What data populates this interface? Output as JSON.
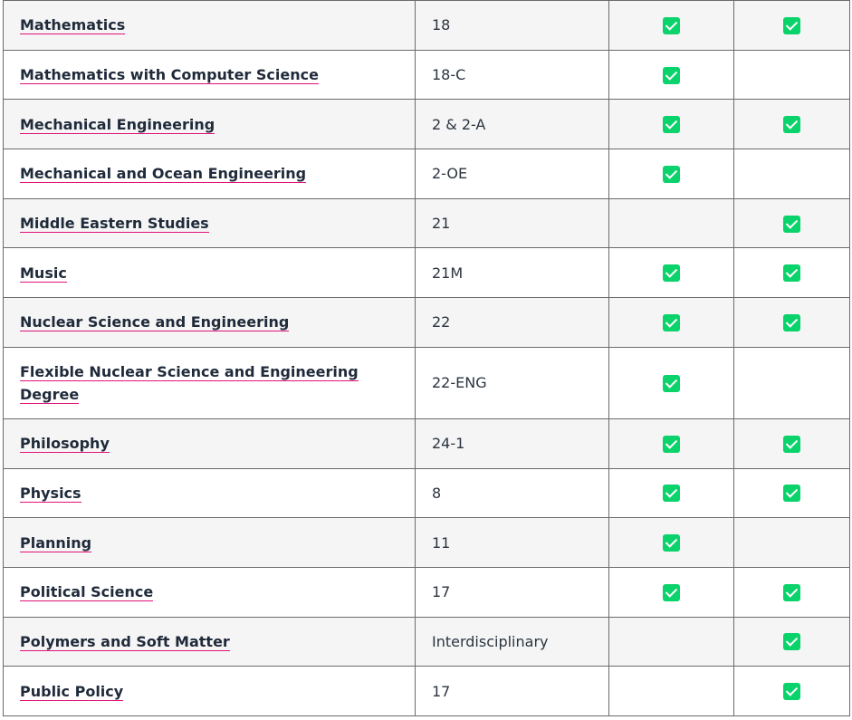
{
  "colors": {
    "check": "#0ad36b",
    "link_underline": "#e0137a",
    "row_alt": "#f5f5f5"
  },
  "rows": [
    {
      "name": "Mathematics",
      "code": "18",
      "col1": true,
      "col2": true
    },
    {
      "name": "Mathematics with Computer Science",
      "code": "18-C",
      "col1": true,
      "col2": false
    },
    {
      "name": "Mechanical Engineering",
      "code": "2 & 2-A",
      "col1": true,
      "col2": true
    },
    {
      "name": "Mechanical and Ocean Engineering",
      "code": "2-OE",
      "col1": true,
      "col2": false
    },
    {
      "name": "Middle Eastern Studies",
      "code": "21",
      "col1": false,
      "col2": true
    },
    {
      "name": "Music",
      "code": "21M",
      "col1": true,
      "col2": true
    },
    {
      "name": "Nuclear Science and Engineering",
      "code": "22",
      "col1": true,
      "col2": true
    },
    {
      "name": "Flexible Nuclear Science and Engineering Degree",
      "code": "22-ENG",
      "col1": true,
      "col2": false
    },
    {
      "name": "Philosophy",
      "code": "24-1",
      "col1": true,
      "col2": true
    },
    {
      "name": "Physics",
      "code": "8",
      "col1": true,
      "col2": true
    },
    {
      "name": "Planning",
      "code": "11",
      "col1": true,
      "col2": false
    },
    {
      "name": "Political Science",
      "code": "17",
      "col1": true,
      "col2": true
    },
    {
      "name": "Polymers and Soft Matter",
      "code": "Interdisciplinary",
      "col1": false,
      "col2": true
    },
    {
      "name": "Public Policy",
      "code": "17",
      "col1": false,
      "col2": true
    }
  ]
}
